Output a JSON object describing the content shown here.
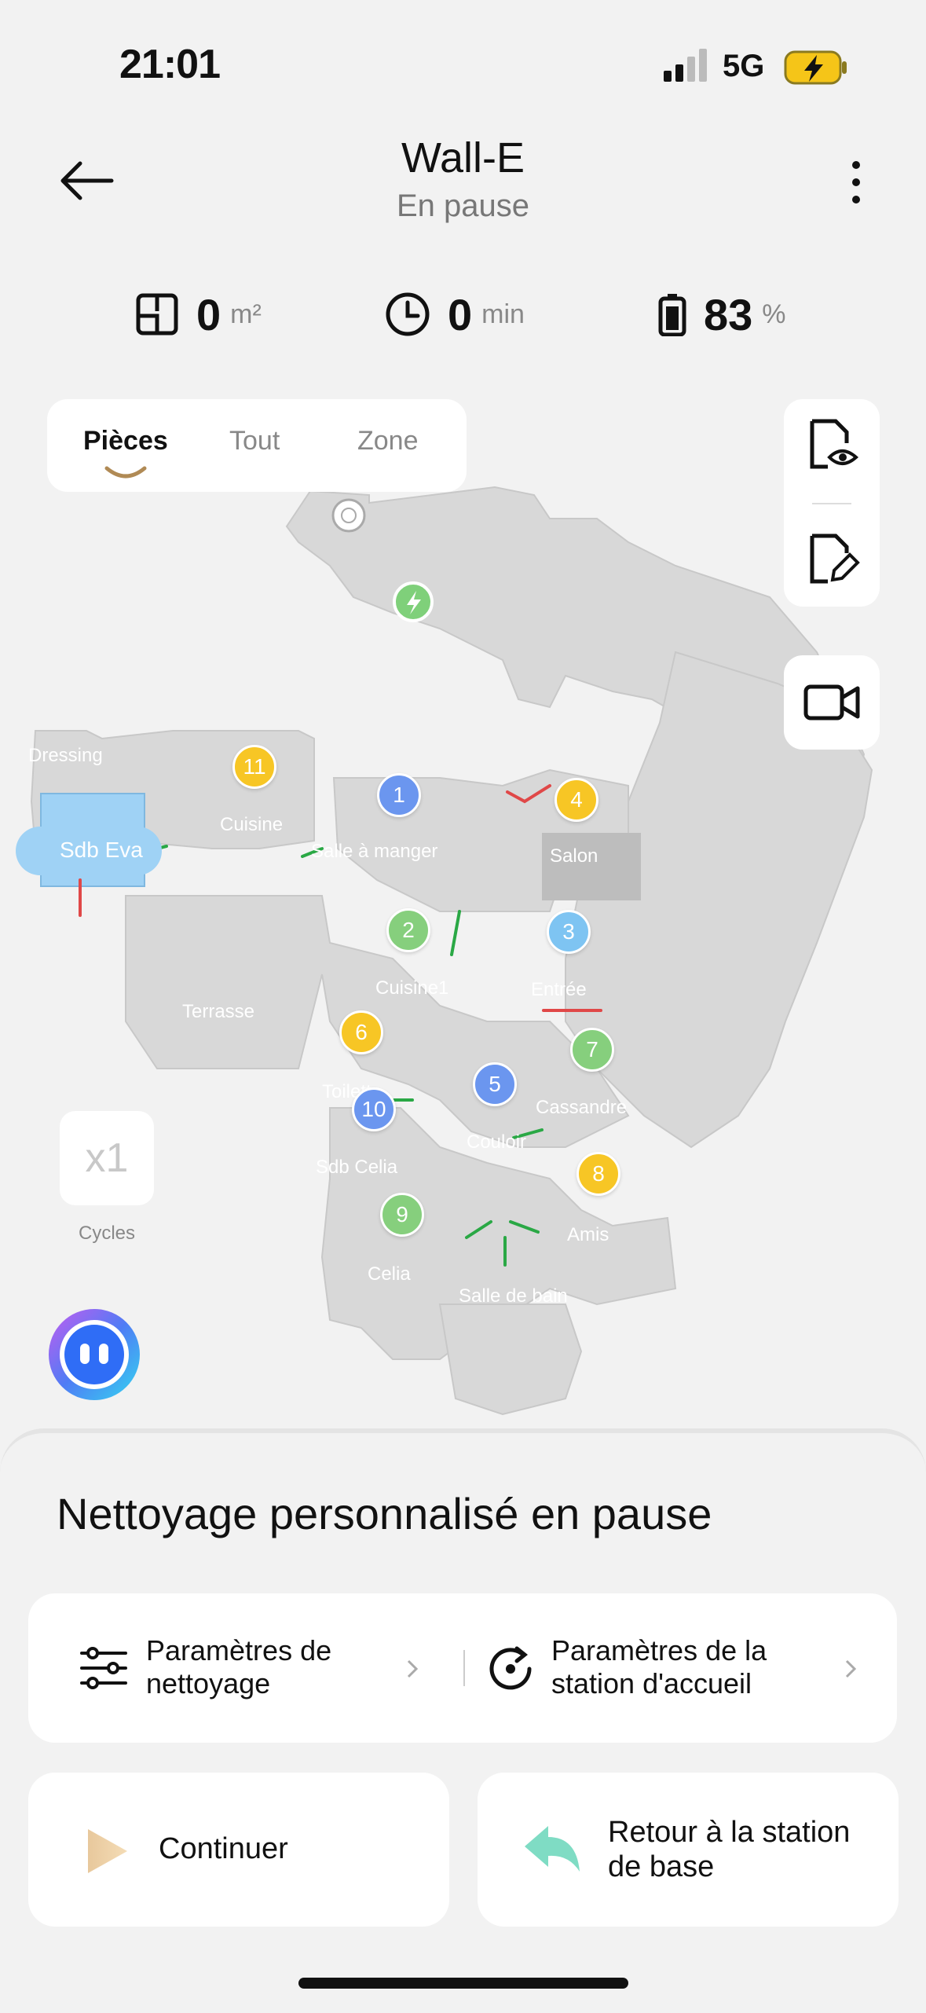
{
  "status_bar": {
    "time": "21:01",
    "network": "5G"
  },
  "header": {
    "title": "Wall-E",
    "subtitle": "En pause"
  },
  "stats": {
    "area": {
      "value": "0",
      "unit": "m²"
    },
    "time": {
      "value": "0",
      "unit": "min"
    },
    "battery": {
      "value": "83",
      "unit": "%"
    }
  },
  "tabs": [
    "Pièces",
    "Tout",
    "Zone"
  ],
  "map": {
    "rooms": [
      "Dressing",
      "Cuisine",
      "Sdb Eva",
      "Salle à manger",
      "Salon",
      "Terrasse",
      "Cuisine1",
      "Entrée",
      "Toilette",
      "Cassandre",
      "Couloir",
      "Sdb Celia",
      "Amis",
      "Celia",
      "Salle de bain"
    ],
    "markers": [
      "1",
      "2",
      "3",
      "4",
      "5",
      "6",
      "7",
      "8",
      "9",
      "10",
      "11"
    ]
  },
  "cycles": {
    "value": "x1",
    "label": "Cycles"
  },
  "sheet": {
    "title": "Nettoyage personnalisé en pause",
    "cleaning_settings": "Paramètres de nettoyage",
    "station_settings": "Paramètres de la station d'accueil",
    "continue": "Continuer",
    "return_base": "Retour à la station de base"
  },
  "icons": [
    "signal-icon",
    "battery-charging-icon",
    "back-arrow-icon",
    "more-icon",
    "area-icon",
    "clock-icon",
    "battery-icon",
    "map-view-icon",
    "map-edit-icon",
    "camera-icon",
    "robot-icon",
    "dock-icon",
    "sliders-icon",
    "station-icon",
    "play-icon",
    "return-icon",
    "assistant-icon"
  ],
  "colors": {
    "accent_green": "#6fcf6a",
    "battery_yellow": "#f5c518",
    "map_gray": "#d8d8d8",
    "sdb_eva_blue": "#9fd2f5"
  }
}
